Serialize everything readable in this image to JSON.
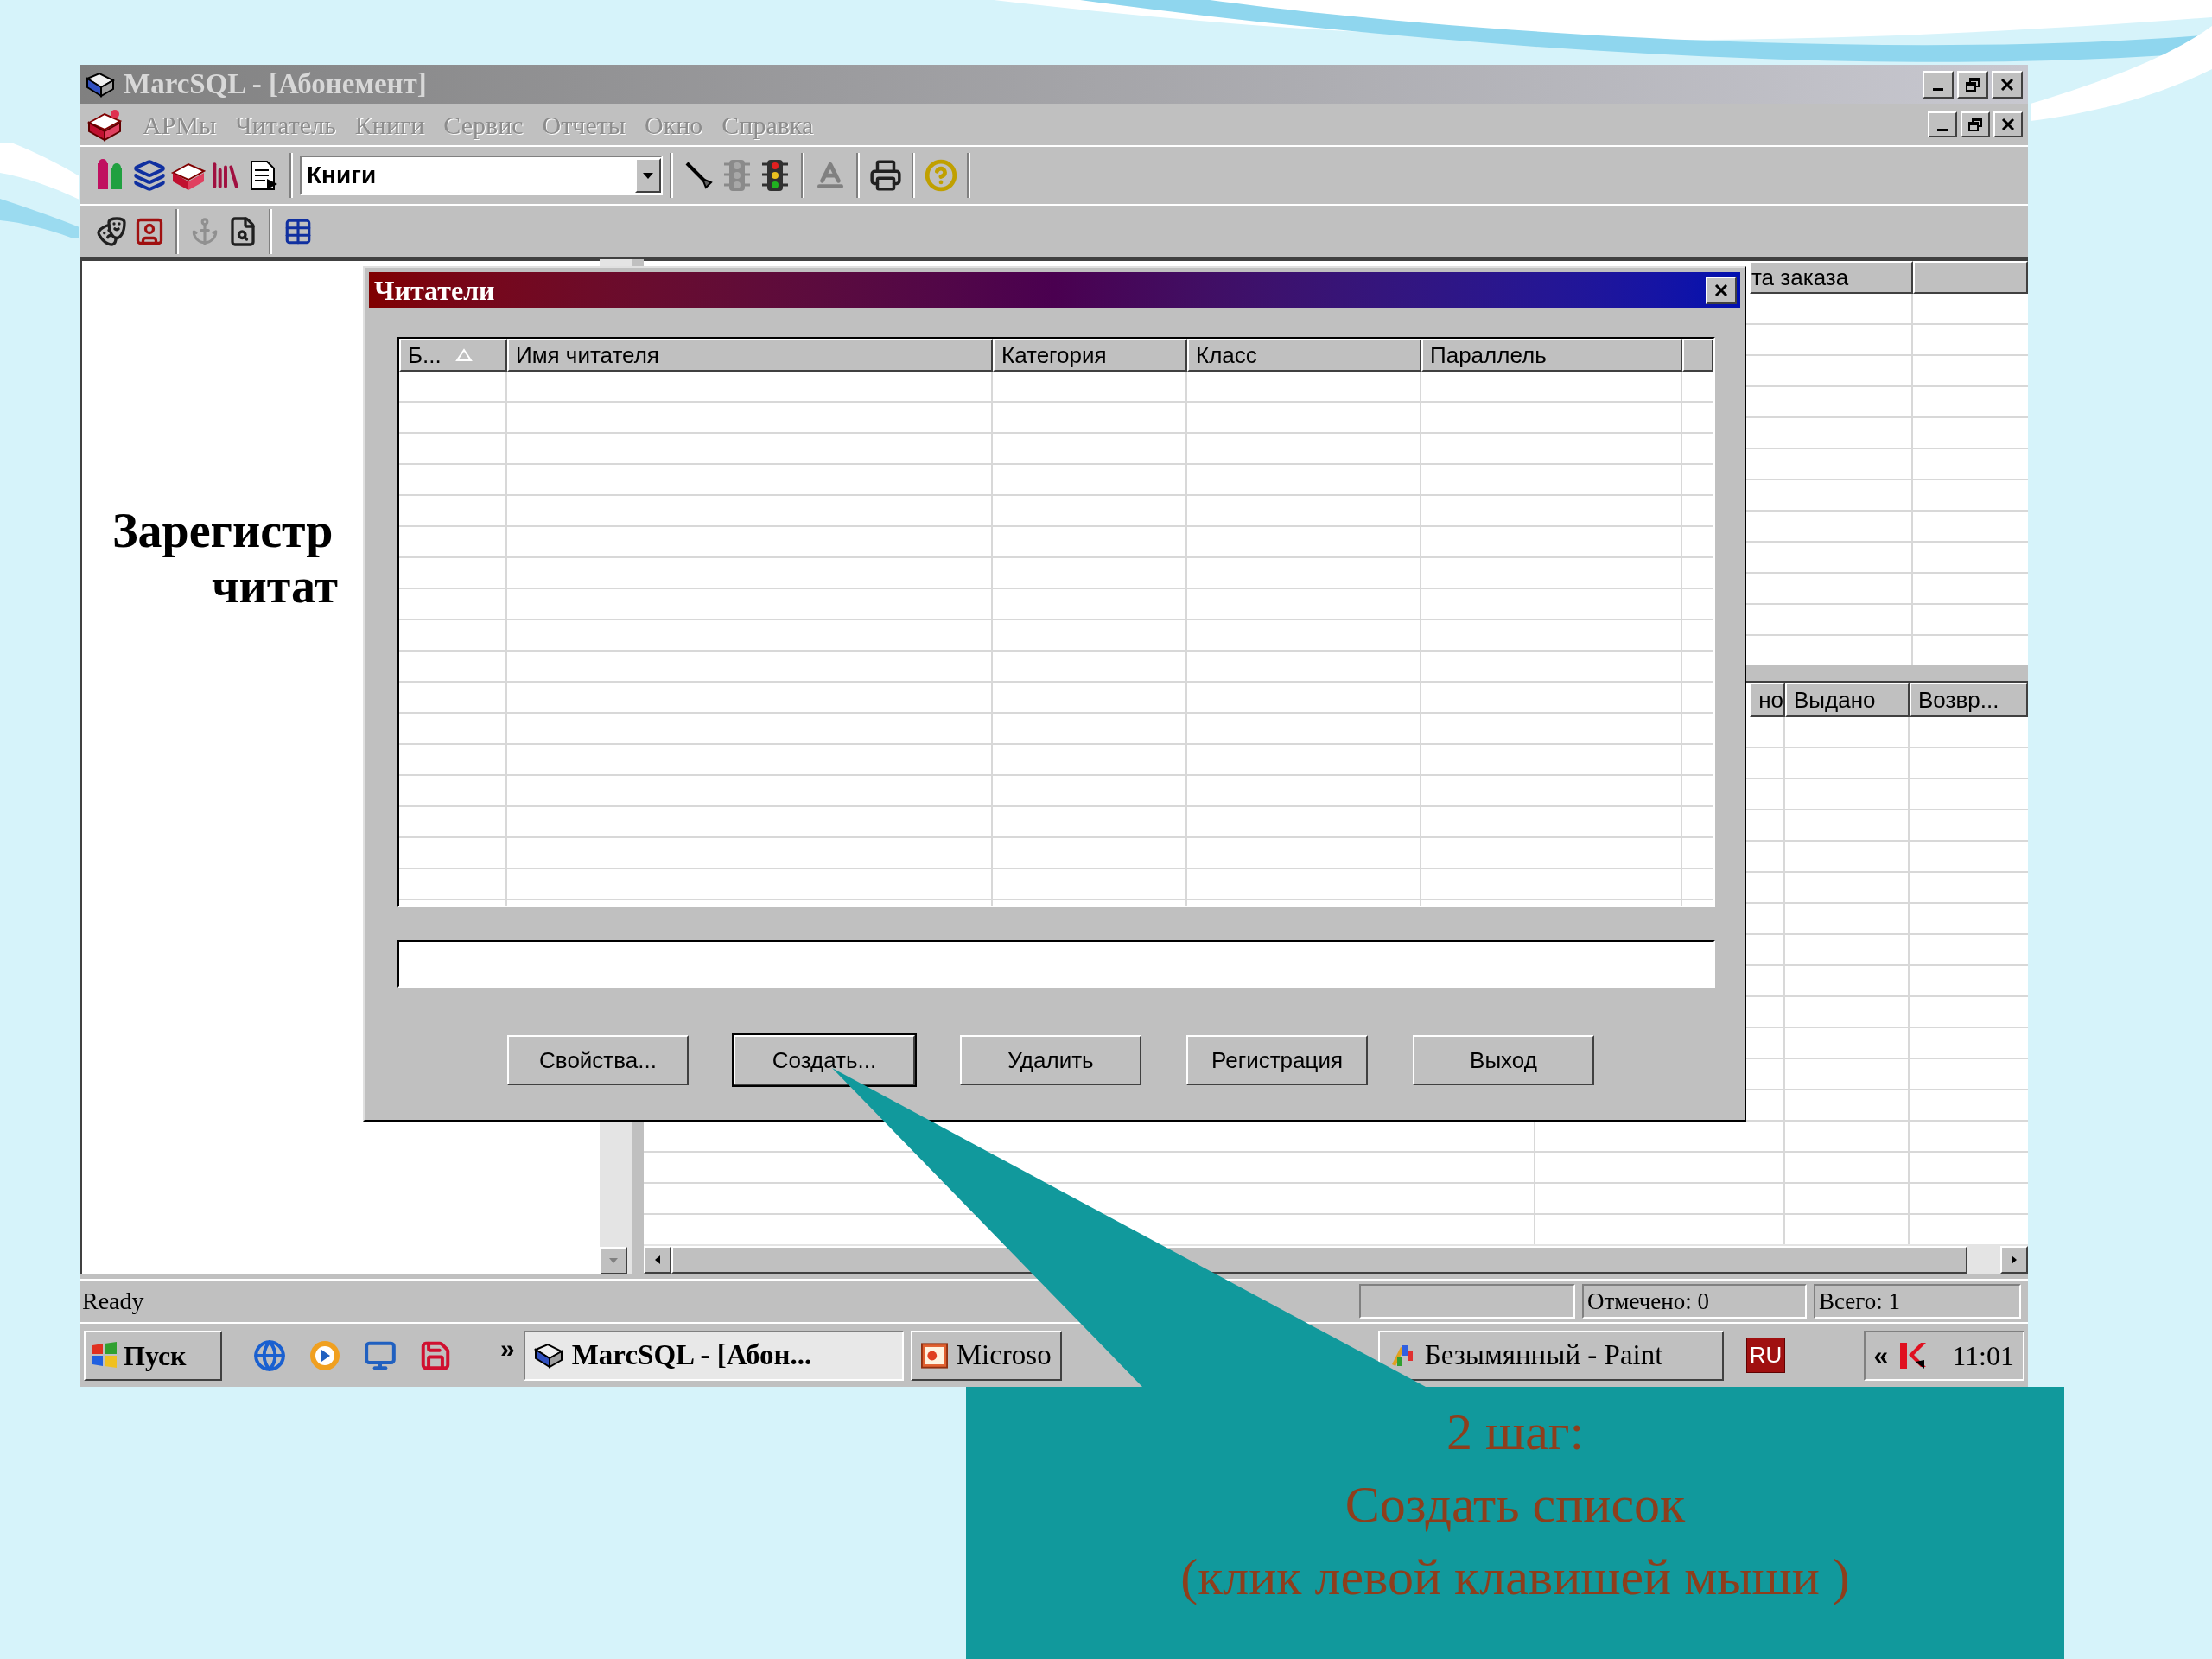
{
  "main_window": {
    "title": "MarcSQL - [Абонемент]",
    "active": false
  },
  "menu": [
    {
      "label": "АРМы",
      "disabled": true
    },
    {
      "label": "Читатель",
      "disabled": true
    },
    {
      "label": "Книги",
      "disabled": true
    },
    {
      "label": "Сервис",
      "disabled": true
    },
    {
      "label": "Отчеты",
      "disabled": true
    },
    {
      "label": "Окно",
      "disabled": true
    },
    {
      "label": "Справка",
      "disabled": true
    }
  ],
  "toolbar": {
    "combo_value": "Книги"
  },
  "left_pane": {
    "lines": [
      "Зарегистр",
      "читат"
    ]
  },
  "upper_list": {
    "columns": [
      "та заказа"
    ]
  },
  "lower_list": {
    "columns": [
      "но",
      "Выдано",
      "Возвр..."
    ]
  },
  "status_bar": {
    "text": "Ready",
    "panels": [
      "Отмечено: 0",
      "Всего: 1"
    ]
  },
  "taskbar": {
    "start": "Пуск",
    "chevron": "»",
    "tasks": [
      {
        "label": "MarcSQL - [Абон...",
        "kind": "app",
        "selected": true
      },
      {
        "label": "Microso",
        "kind": "presentation",
        "selected": false
      },
      {
        "label": "Безымянный - Paint",
        "kind": "paint",
        "selected": false
      }
    ],
    "language": "RU",
    "tray_chevron": "«",
    "clock": "11:01"
  },
  "dialog": {
    "title": "Читатели",
    "active": true,
    "columns": [
      {
        "label": "Б...",
        "sorted": true
      },
      {
        "label": "Имя читателя",
        "sorted": false
      },
      {
        "label": "Категория",
        "sorted": false
      },
      {
        "label": "Класс",
        "sorted": false
      },
      {
        "label": "Параллель",
        "sorted": false
      }
    ],
    "buttons": [
      {
        "label": "Свойства...",
        "default": false
      },
      {
        "label": "Создать...",
        "default": true
      },
      {
        "label": "Удалить",
        "default": false
      },
      {
        "label": "Регистрация",
        "default": false
      },
      {
        "label": "Выход",
        "default": false
      }
    ]
  },
  "callout": {
    "lines": [
      "2 шаг:",
      "Создать список",
      "(клик левой клавишей мыши )"
    ]
  }
}
